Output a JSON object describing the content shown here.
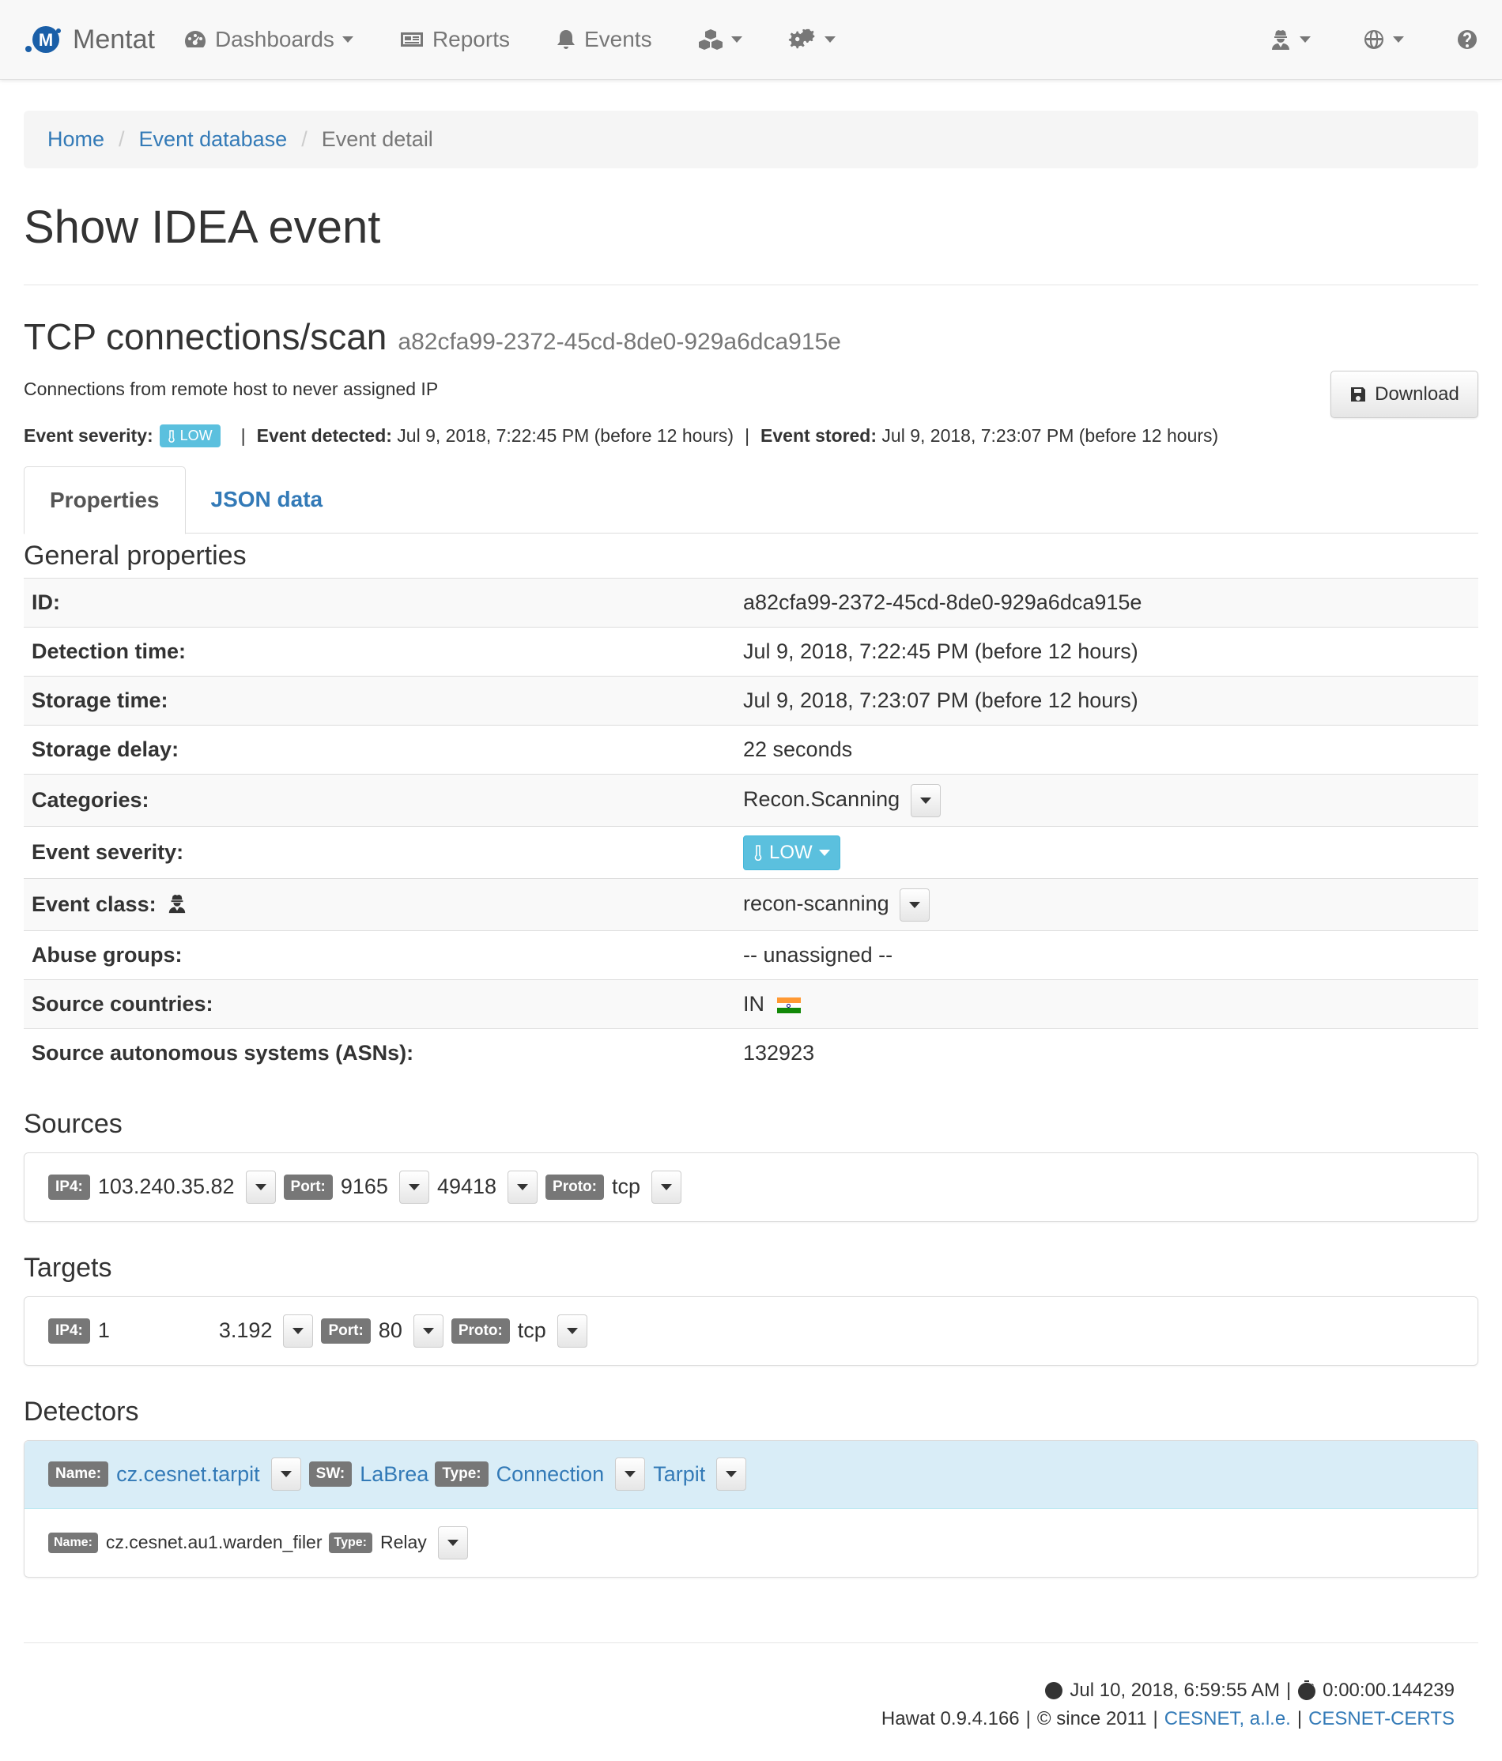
{
  "nav": {
    "brand": "Mentat",
    "dashboards": "Dashboards",
    "reports": "Reports",
    "events": "Events"
  },
  "breadcrumb": {
    "home": "Home",
    "event_database": "Event database",
    "current": "Event detail"
  },
  "page_title": "Show IDEA event",
  "event": {
    "title": "TCP connections/scan",
    "id": "a82cfa99-2372-45cd-8de0-929a6dca915e",
    "description": "Connections from remote host to never assigned IP",
    "download_label": "Download",
    "severity_label": "Event severity:",
    "severity": "LOW",
    "detected_label": "Event detected:",
    "detected": "Jul 9, 2018, 7:22:45 PM (before 12 hours)",
    "stored_label": "Event stored:",
    "stored": "Jul 9, 2018, 7:23:07 PM (before 12 hours)",
    "severity_color": "#5bc0de"
  },
  "tabs": {
    "properties": "Properties",
    "json": "JSON data"
  },
  "general": {
    "title": "General properties",
    "id_label": "ID:",
    "id": "a82cfa99-2372-45cd-8de0-929a6dca915e",
    "detection_label": "Detection time:",
    "detection": "Jul 9, 2018, 7:22:45 PM (before 12 hours)",
    "storage_label": "Storage time:",
    "storage": "Jul 9, 2018, 7:23:07 PM (before 12 hours)",
    "delay_label": "Storage delay:",
    "delay": "22 seconds",
    "categories_label": "Categories:",
    "categories": "Recon.Scanning",
    "severity_label": "Event severity:",
    "severity": "LOW",
    "class_label": "Event class:",
    "class": "recon-scanning",
    "abuse_label": "Abuse groups:",
    "abuse": "-- unassigned --",
    "countries_label": "Source countries:",
    "countries": "IN",
    "asn_label": "Source autonomous systems (ASNs):",
    "asn": "132923"
  },
  "sources": {
    "title": "Sources",
    "ip4_tag": "IP4:",
    "ip4": "103.240.35.82",
    "port_tag": "Port:",
    "port1": "9165",
    "port2": "49418",
    "proto_tag": "Proto:",
    "proto": "tcp"
  },
  "targets": {
    "title": "Targets",
    "ip4_tag": "IP4:",
    "ip4_start": "1",
    "ip4_end": "3.192",
    "port_tag": "Port:",
    "port": "80",
    "proto_tag": "Proto:",
    "proto": "tcp"
  },
  "detectors": {
    "title": "Detectors",
    "d1": {
      "name_tag": "Name:",
      "name": "cz.cesnet.tarpit",
      "sw_tag": "SW:",
      "sw": "LaBrea",
      "type_tag": "Type:",
      "type1": "Connection",
      "type2": "Tarpit"
    },
    "d2": {
      "name_tag": "Name:",
      "name": "cz.cesnet.au1.warden_filer",
      "type_tag": "Type:",
      "type": "Relay"
    }
  },
  "footer": {
    "time": "Jul 10, 2018, 6:59:55 AM",
    "duration": "0:00:00.144239",
    "version": "Hawat 0.9.4.166",
    "since": "© since 2011",
    "cesnet": "CESNET, a.l.e.",
    "certs": "CESNET-CERTS",
    "sep": "|"
  }
}
